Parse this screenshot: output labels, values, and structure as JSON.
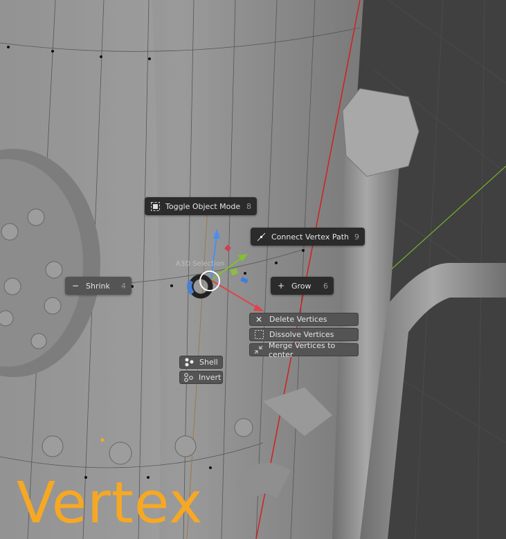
{
  "pie_menu": {
    "title": "A3D Selection",
    "items": [
      {
        "label": "Toggle Object Mode",
        "key": "8",
        "icon": "square-select-icon"
      },
      {
        "label": "Connect Vertex Path",
        "key": "9",
        "icon": "connect-path-icon"
      },
      {
        "label": "Shrink",
        "key": "4",
        "icon": "minus-icon"
      },
      {
        "label": "Grow",
        "key": "6",
        "icon": "plus-icon"
      }
    ],
    "submenu": [
      {
        "label": "Delete Vertices",
        "icon": "x-icon"
      },
      {
        "label": "Dissolve Vertices",
        "icon": "dotted-square-icon"
      },
      {
        "label": "Merge Vertices to center",
        "icon": "merge-icon"
      }
    ],
    "select_buttons": [
      {
        "label": "Shell",
        "icon": "shell-icon"
      },
      {
        "label": "Invert",
        "icon": "invert-icon"
      }
    ]
  },
  "overlay_text": "Vertex",
  "colors": {
    "accent": "#f7a823",
    "x_axis": "#e0424f",
    "y_axis": "#7ec32b",
    "z_axis": "#4a8ff0"
  }
}
